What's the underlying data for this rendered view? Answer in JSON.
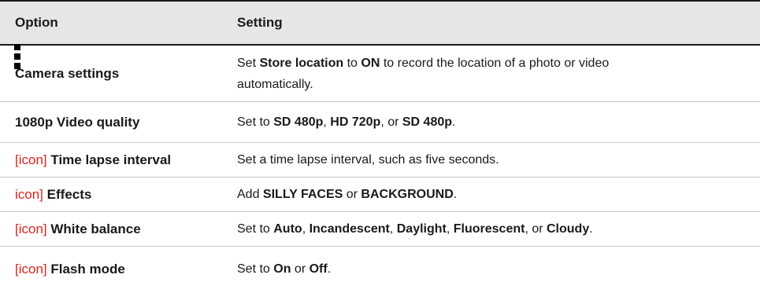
{
  "header": {
    "option": "Option",
    "setting": "Setting"
  },
  "rows": [
    {
      "icon": "[icon]",
      "option": "Camera settings",
      "setting": [
        {
          "t": "Set ",
          "b": false
        },
        {
          "t": "Store location",
          "b": true
        },
        {
          "t": " to ",
          "b": false
        },
        {
          "t": "ON",
          "b": true
        },
        {
          "t": " to record the location of a photo or video",
          "b": false
        },
        {
          "t": "automatically.",
          "b": false
        }
      ]
    },
    {
      "icon": "",
      "option": "1080p Video quality",
      "setting": [
        {
          "t": "Set to ",
          "b": false
        },
        {
          "t": "SD 480p",
          "b": true
        },
        {
          "t": ", ",
          "b": false
        },
        {
          "t": "HD 720p",
          "b": true
        },
        {
          "t": ", or ",
          "b": false
        },
        {
          "t": "SD 480p",
          "b": true
        },
        {
          "t": ".",
          "b": false
        }
      ]
    },
    {
      "icon": "[icon]",
      "option": "Time lapse interval",
      "setting": [
        {
          "t": "Set a time lapse interval, such as five seconds.",
          "b": false
        }
      ]
    },
    {
      "icon": "icon]",
      "option": "Effects",
      "setting": [
        {
          "t": "Add ",
          "b": false
        },
        {
          "t": "SILLY FACES",
          "b": true
        },
        {
          "t": " or ",
          "b": false
        },
        {
          "t": "BACKGROUND",
          "b": true
        },
        {
          "t": ".",
          "b": false
        }
      ]
    },
    {
      "icon": "[icon]",
      "option": "White balance",
      "setting": [
        {
          "t": "Set to ",
          "b": false
        },
        {
          "t": "Auto",
          "b": true
        },
        {
          "t": ", ",
          "b": false
        },
        {
          "t": "Incandescent",
          "b": true
        },
        {
          "t": ", ",
          "b": false
        },
        {
          "t": "Daylight",
          "b": true
        },
        {
          "t": ", ",
          "b": false
        },
        {
          "t": "Fluorescent",
          "b": true
        },
        {
          "t": ", or ",
          "b": false
        },
        {
          "t": "Cloudy",
          "b": true
        },
        {
          "t": ".",
          "b": false
        }
      ]
    },
    {
      "icon": "[icon]",
      "option": "Flash mode",
      "setting": [
        {
          "t": "Set to ",
          "b": false
        },
        {
          "t": "On",
          "b": true
        },
        {
          "t": " or ",
          "b": false
        },
        {
          "t": "Off",
          "b": true
        },
        {
          "t": ".",
          "b": false
        }
      ]
    }
  ],
  "colors": {
    "header_bg": "#e6e6e6",
    "icon_placeholder": "#e0231e",
    "rule": "#1a1a1a"
  }
}
